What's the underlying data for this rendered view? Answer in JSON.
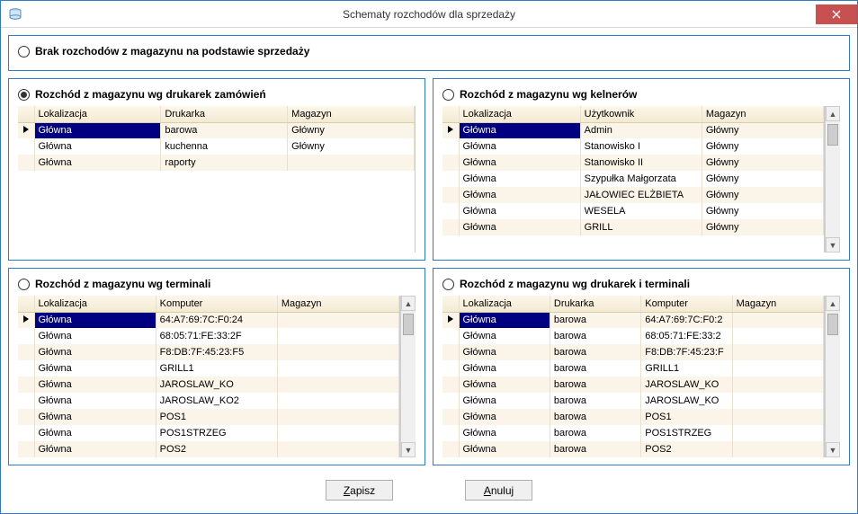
{
  "window": {
    "title": "Schematy rozchodów dla sprzedaży"
  },
  "topOption": {
    "label": "Brak rozchodów z magazynu na podstawie sprzedaży",
    "selected": false
  },
  "panels": {
    "printers": {
      "label": "Rozchód z magazynu wg drukarek zamówień",
      "selected": true,
      "headers": [
        "Lokalizacja",
        "Drukarka",
        "Magazyn"
      ],
      "rows": [
        [
          "Główna",
          "barowa",
          "Główny"
        ],
        [
          "Główna",
          "kuchenna",
          "Główny"
        ],
        [
          "Główna",
          "raporty",
          ""
        ]
      ],
      "selectedRow": 0,
      "scroll": false
    },
    "waiters": {
      "label": "Rozchód z magazynu wg kelnerów",
      "selected": false,
      "headers": [
        "Lokalizacja",
        "Użytkownik",
        "Magazyn"
      ],
      "rows": [
        [
          "Główna",
          "Admin",
          "Główny"
        ],
        [
          "Główna",
          "Stanowisko I",
          "Główny"
        ],
        [
          "Główna",
          "Stanowisko II",
          "Główny"
        ],
        [
          "Główna",
          "Szypułka Małgorzata",
          "Główny"
        ],
        [
          "Główna",
          "JAŁOWIEC ELŻBIETA",
          "Główny"
        ],
        [
          "Główna",
          "WESELA",
          "Główny"
        ],
        [
          "Główna",
          "GRILL",
          "Główny"
        ]
      ],
      "selectedRow": 0,
      "scroll": true
    },
    "terminals": {
      "label": "Rozchód z magazynu wg terminali",
      "selected": false,
      "headers": [
        "Lokalizacja",
        "Komputer",
        "Magazyn"
      ],
      "rows": [
        [
          "Główna",
          "64:A7:69:7C:F0:24",
          ""
        ],
        [
          "Główna",
          "68:05:71:FE:33:2F",
          ""
        ],
        [
          "Główna",
          "F8:DB:7F:45:23:F5",
          ""
        ],
        [
          "Główna",
          "GRILL1",
          ""
        ],
        [
          "Główna",
          "JAROSLAW_KO",
          ""
        ],
        [
          "Główna",
          "JAROSLAW_KO2",
          ""
        ],
        [
          "Główna",
          "POS1",
          ""
        ],
        [
          "Główna",
          "POS1STRZEG",
          ""
        ],
        [
          "Główna",
          "POS2",
          ""
        ]
      ],
      "selectedRow": 0,
      "scroll": true
    },
    "printersTerminals": {
      "label": "Rozchód z magazynu wg drukarek i terminali",
      "selected": false,
      "headers": [
        "Lokalizacja",
        "Drukarka",
        "Komputer",
        "Magazyn"
      ],
      "rows": [
        [
          "Główna",
          "barowa",
          "64:A7:69:7C:F0:2",
          ""
        ],
        [
          "Główna",
          "barowa",
          "68:05:71:FE:33:2",
          ""
        ],
        [
          "Główna",
          "barowa",
          "F8:DB:7F:45:23:F",
          ""
        ],
        [
          "Główna",
          "barowa",
          "GRILL1",
          ""
        ],
        [
          "Główna",
          "barowa",
          "JAROSLAW_KO",
          ""
        ],
        [
          "Główna",
          "barowa",
          "JAROSLAW_KO",
          ""
        ],
        [
          "Główna",
          "barowa",
          "POS1",
          ""
        ],
        [
          "Główna",
          "barowa",
          "POS1STRZEG",
          ""
        ],
        [
          "Główna",
          "barowa",
          "POS2",
          ""
        ]
      ],
      "selectedRow": 0,
      "scroll": true
    }
  },
  "buttons": {
    "save": "Zapisz",
    "cancel": "Anuluj"
  }
}
